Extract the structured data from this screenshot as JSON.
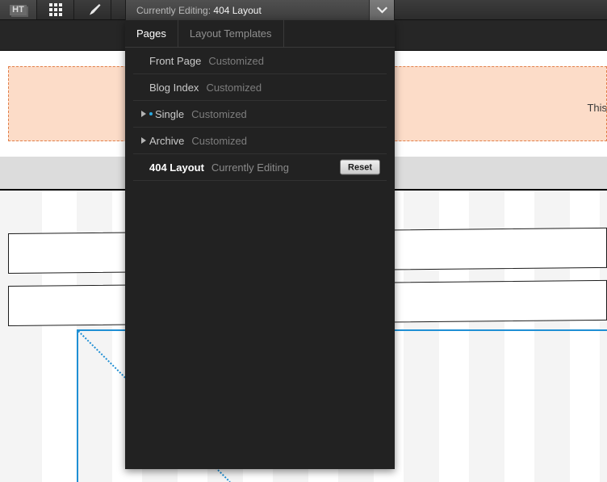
{
  "toolbar": {
    "logo": "HT",
    "logo_icon": "ht-logo-icon",
    "grid_icon": "grid-9-icon",
    "brush_icon": "paintbrush-icon",
    "editing_prefix": "Currently Editing:",
    "editing_target": "404 Layout",
    "chevron_icon": "chevron-down-icon"
  },
  "panel": {
    "tabs": [
      {
        "label": "Pages",
        "active": true
      },
      {
        "label": "Layout Templates",
        "active": false
      }
    ],
    "rows": [
      {
        "name": "Front Page",
        "state": "Customized",
        "expandable": false,
        "dot": false,
        "current": false,
        "reset": null
      },
      {
        "name": "Blog Index",
        "state": "Customized",
        "expandable": false,
        "dot": false,
        "current": false,
        "reset": null
      },
      {
        "name": "Single",
        "state": "Customized",
        "expandable": true,
        "dot": true,
        "current": false,
        "reset": null
      },
      {
        "name": "Archive",
        "state": "Customized",
        "expandable": true,
        "dot": false,
        "current": false,
        "reset": null
      },
      {
        "name": "404 Layout",
        "state": "Currently Editing",
        "expandable": false,
        "dot": false,
        "current": true,
        "reset": "Reset"
      }
    ]
  },
  "canvas": {
    "hero_text": "This",
    "hero_fill": "#fcdcc8",
    "hero_border": "#e2804b",
    "band_color": "#dcdcdc",
    "guide_color": "#f4f4f4",
    "accent_blue": "#1f8fd4"
  }
}
